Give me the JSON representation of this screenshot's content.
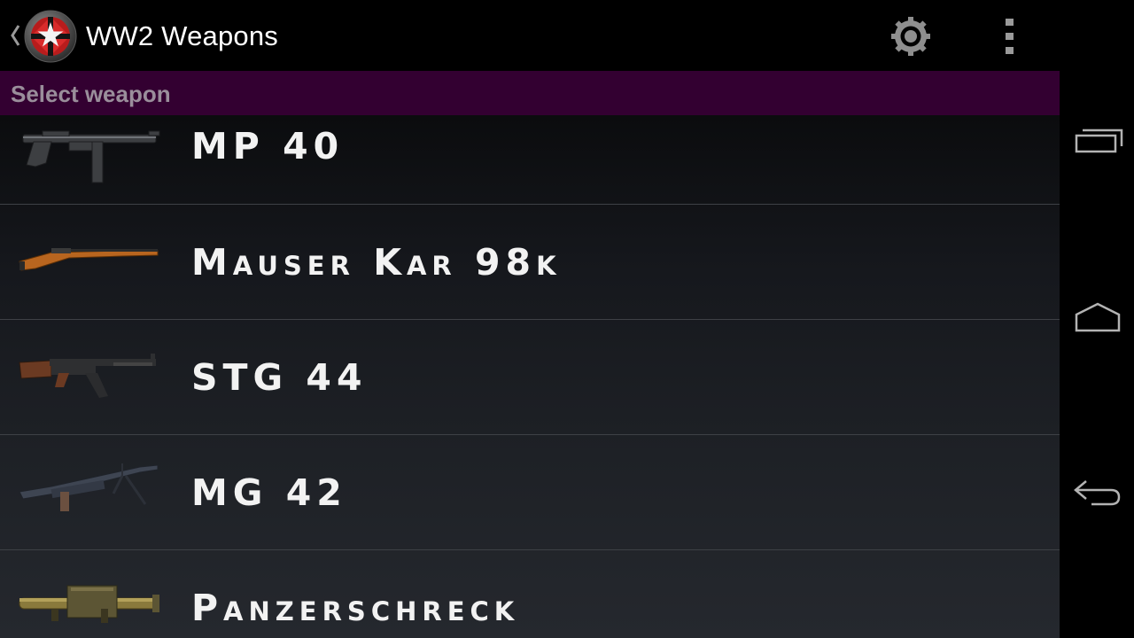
{
  "action_bar": {
    "title": "WW2 Weapons",
    "icons": {
      "up": "chevron-left-icon",
      "logo": "app-logo-icon",
      "settings": "settings-gear-icon",
      "overflow": "overflow-menu-icon"
    }
  },
  "subheader": {
    "label": "Select weapon",
    "color": "#330031"
  },
  "weapons": [
    {
      "name": "MP 40",
      "icon": "mp40-weapon-image"
    },
    {
      "name": "Mauser Kar 98k",
      "icon": "kar98k-weapon-image"
    },
    {
      "name": "STG 44",
      "icon": "stg44-weapon-image"
    },
    {
      "name": "MG 42",
      "icon": "mg42-weapon-image"
    },
    {
      "name": "Panzerschreck",
      "icon": "panzerschreck-weapon-image"
    }
  ],
  "navigation_bar": {
    "buttons": [
      "recent-apps-icon",
      "home-icon",
      "back-icon"
    ]
  }
}
